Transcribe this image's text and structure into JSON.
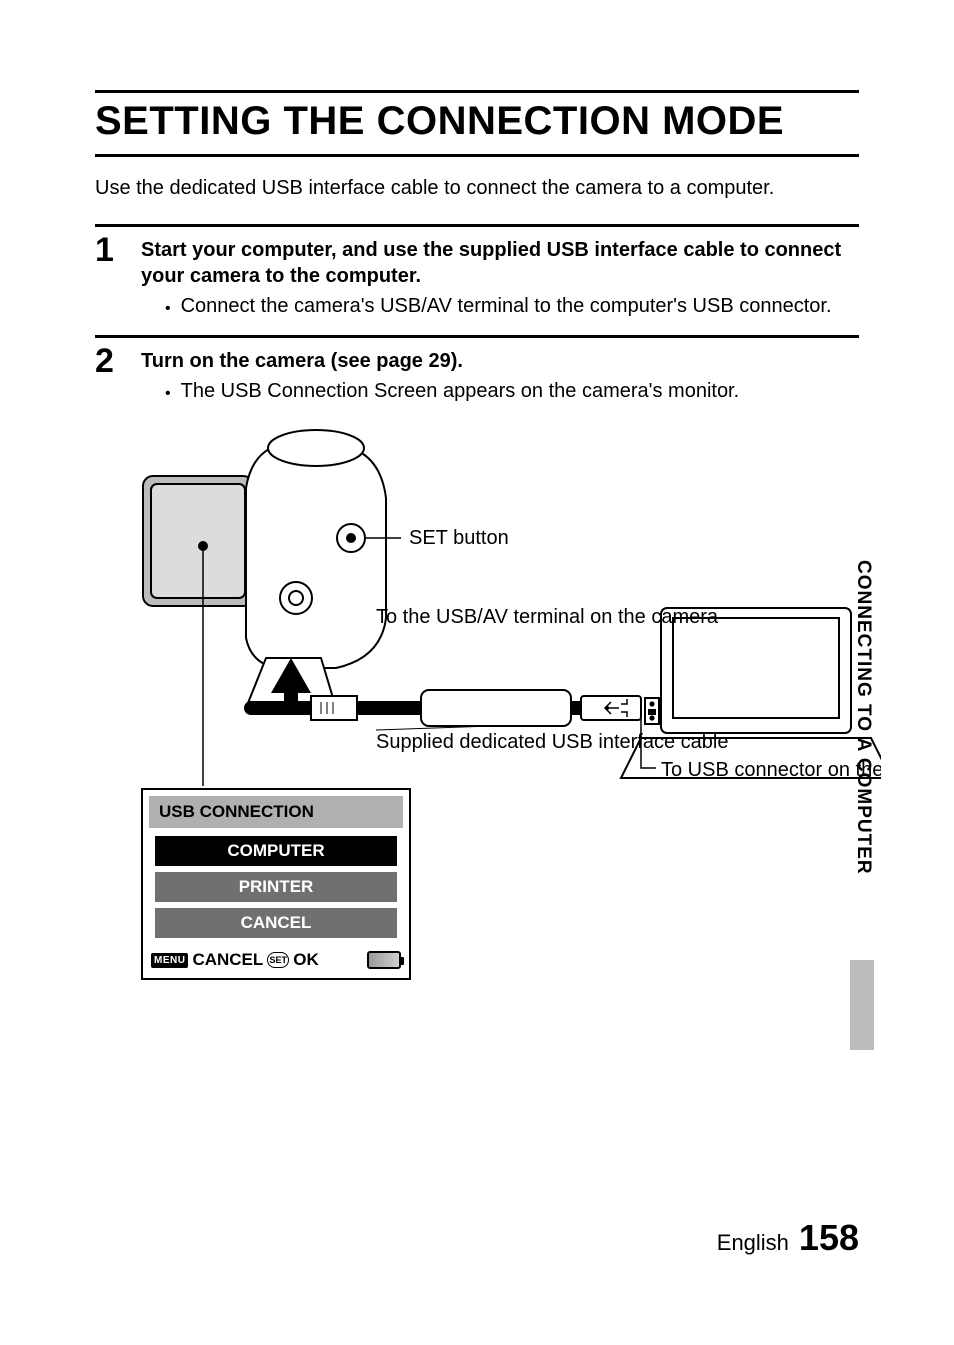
{
  "title": "SETTING THE CONNECTION MODE",
  "intro": "Use the dedicated USB interface cable to connect the camera to a computer.",
  "steps": {
    "s1": {
      "num": "1",
      "head": "Start your computer, and use the supplied USB interface cable to connect your camera to the computer.",
      "bullet": "Connect the camera's USB/AV terminal to the computer's USB connector."
    },
    "s2": {
      "num": "2",
      "head": "Turn on the camera  (see page 29).",
      "bullet": "The USB Connection Screen appears on the camera's monitor."
    }
  },
  "diagram": {
    "set_button": "SET button",
    "usb_av_terminal": "To the USB/AV terminal on the camera",
    "cable": "Supplied dedicated USB interface cable",
    "to_computer": "To USB connector on the computer"
  },
  "menu": {
    "title": "USB CONNECTION",
    "item1": "COMPUTER",
    "item2": "PRINTER",
    "item3": "CANCEL",
    "footer_menu": "MENU",
    "footer_cancel": "CANCEL",
    "footer_set": "SET",
    "footer_ok": "OK"
  },
  "side_tab": "CONNECTING TO A COMPUTER",
  "footer": {
    "lang": "English",
    "page": "158"
  }
}
